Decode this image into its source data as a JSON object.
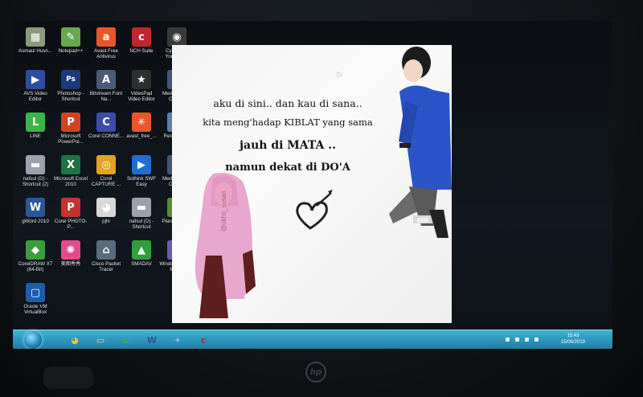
{
  "desktop_icons": [
    {
      "label": "Asmaul Husn...",
      "icon": "document-icon",
      "color": "#8a9a7a",
      "glyph": "▦"
    },
    {
      "label": "Notepad++",
      "icon": "notepadpp-icon",
      "color": "#6aa84f",
      "glyph": "✎"
    },
    {
      "label": "Avast Free Antivirus",
      "icon": "avast-icon",
      "color": "#e8562a",
      "glyph": "a"
    },
    {
      "label": "NCH Suite",
      "icon": "nch-icon",
      "color": "#c0272d",
      "glyph": "c"
    },
    {
      "label": "CyberLink YouCam 5",
      "icon": "webcam-icon",
      "color": "#3a3a3a",
      "glyph": "◉"
    },
    {
      "label": "AVS Video Editor",
      "icon": "avs-icon",
      "color": "#2b4f9c",
      "glyph": "▶"
    },
    {
      "label": "Photoshop - Shortcut",
      "icon": "photoshop-icon",
      "color": "#1a3a78",
      "glyph": "Ps"
    },
    {
      "label": "Bitstream Font Na...",
      "icon": "bitstream-icon",
      "color": "#4a5a78",
      "glyph": "A"
    },
    {
      "label": "VideoPad Video Editor",
      "icon": "videopad-icon",
      "color": "#2f2f2f",
      "glyph": "★"
    },
    {
      "label": "Media Player Classic",
      "icon": "mpc-icon",
      "color": "#445577",
      "glyph": "21"
    },
    {
      "label": "LINE",
      "icon": "line-icon",
      "color": "#39b54a",
      "glyph": "L"
    },
    {
      "label": "Microsoft PowerPoi...",
      "icon": "powerpoint-icon",
      "color": "#d04423",
      "glyph": "P"
    },
    {
      "label": "Corel CONNE...",
      "icon": "corel-connect-icon",
      "color": "#3c4da8",
      "glyph": "C"
    },
    {
      "label": "avast_free_...",
      "icon": "avast-installer-icon",
      "color": "#e8562a",
      "glyph": "✳"
    },
    {
      "label": "Recycle Bin",
      "icon": "recycle-bin-icon",
      "color": "#5d7fa8",
      "glyph": "♻"
    },
    {
      "label": "nafsul (D) - Shortcut (2)",
      "icon": "drive-shortcut-icon",
      "color": "#9aa3ad",
      "glyph": "▬"
    },
    {
      "label": "Microsoft Excel 2010",
      "icon": "excel-icon",
      "color": "#1f7244",
      "glyph": "X"
    },
    {
      "label": "Corel CAPTURE ...",
      "icon": "corel-capture-icon",
      "color": "#e2a31e",
      "glyph": "◎"
    },
    {
      "label": "Sothink SWF Easy",
      "icon": "sothink-icon",
      "color": "#1f6fd1",
      "glyph": "▶"
    },
    {
      "label": "Media Player Classic",
      "icon": "mpc-icon-2",
      "color": "#445577",
      "glyph": "21"
    },
    {
      "label": "gWord 2010",
      "icon": "word-icon",
      "color": "#2b5797",
      "glyph": "W"
    },
    {
      "label": "Corel PHOTO-P...",
      "icon": "corel-photopaint-icon",
      "color": "#c43232",
      "glyph": "P"
    },
    {
      "label": "pjhi",
      "icon": "chrome-icon",
      "color": "#d8d8d8",
      "glyph": "◕"
    },
    {
      "label": "nafsul (D) - Shortcut",
      "icon": "drive-shortcut-icon-2",
      "color": "#9aa3ad",
      "glyph": "▬"
    },
    {
      "label": "PlantsVsZo...",
      "icon": "pvz-icon",
      "color": "#5c8d2b",
      "glyph": "✿"
    },
    {
      "label": "CorelDRAW X7 (64-Bit)",
      "icon": "coreldraw-icon",
      "color": "#3c9d3c",
      "glyph": "◆"
    },
    {
      "label": "美图秀秀",
      "icon": "meitu-icon",
      "color": "#e24c8a",
      "glyph": "✺"
    },
    {
      "label": "Cisco Packet Tracer",
      "icon": "cisco-icon",
      "color": "#5a6b7c",
      "glyph": "⌂"
    },
    {
      "label": "SMADAV",
      "icon": "smadav-icon",
      "color": "#2e9f3a",
      "glyph": "▲"
    },
    {
      "label": "Windows Movie Maker",
      "icon": "movie-maker-icon",
      "color": "#6a5bb0",
      "glyph": "▣"
    },
    {
      "label": "Oracle VM VirtualBox",
      "icon": "virtualbox-icon",
      "color": "#1a5fa8",
      "glyph": "▢"
    }
  ],
  "wallpaper": {
    "line1": "aku di sini.. dan kau di sana..",
    "line2": "kita meng'hadap KIBLAT yang sama",
    "line3": "jauh di MATA ..",
    "line4": "namun dekat di DO'A",
    "watermark": "@ukhti_susan"
  },
  "taskbar": {
    "apps": [
      {
        "name": "chrome-taskbar-icon",
        "glyph": "◕",
        "color": "#f1c232"
      },
      {
        "name": "explorer-taskbar-icon",
        "glyph": "▭",
        "color": "#f6d36b"
      },
      {
        "name": "line-taskbar-icon",
        "glyph": "L",
        "color": "#39b54a"
      },
      {
        "name": "word-taskbar-icon",
        "glyph": "W",
        "color": "#2b5797"
      },
      {
        "name": "network-tool-taskbar-icon",
        "glyph": "✦",
        "color": "#8fb7d9"
      },
      {
        "name": "nch-taskbar-icon",
        "glyph": "c",
        "color": "#c0272d"
      }
    ],
    "time": "15:43",
    "date": "15/06/2019"
  },
  "bezel": {
    "brand": "hp"
  }
}
